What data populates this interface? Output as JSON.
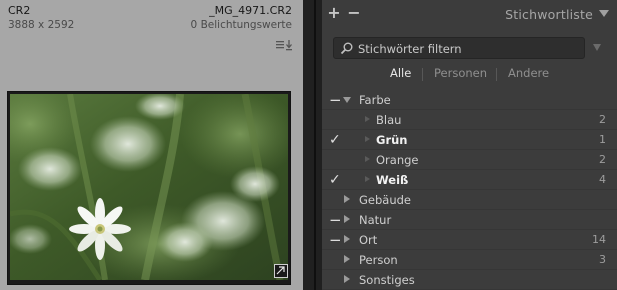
{
  "grid_cell": {
    "filename_left": "CR2",
    "dimensions": "3888 x 2592",
    "filename_right": "_MG_4971.CR2",
    "flags": "0 Belichtungswerte",
    "meta_icon": "metadata-menu-icon",
    "badge_icon": "crop-badge-icon"
  },
  "keyword_panel": {
    "title": "Stichwortliste",
    "add_label": "+",
    "remove_label": "−",
    "filter_placeholder": "Stichwörter filtern",
    "tabs": [
      {
        "label": "Alle",
        "active": true
      },
      {
        "label": "Personen",
        "active": false
      },
      {
        "label": "Andere",
        "active": false
      }
    ],
    "keywords": [
      {
        "mark": "−",
        "expand": "down",
        "label": "Farbe",
        "count": "",
        "level": 0
      },
      {
        "mark": "",
        "expand": "",
        "label": "Blau",
        "count": "2",
        "level": 1
      },
      {
        "mark": "✓",
        "expand": "",
        "label": "Grün",
        "count": "1",
        "level": 1
      },
      {
        "mark": "",
        "expand": "",
        "label": "Orange",
        "count": "2",
        "level": 1
      },
      {
        "mark": "✓",
        "expand": "",
        "label": "Weiß",
        "count": "4",
        "level": 1
      },
      {
        "mark": "",
        "expand": "right",
        "label": "Gebäude",
        "count": "",
        "level": 0
      },
      {
        "mark": "−",
        "expand": "right",
        "label": "Natur",
        "count": "",
        "level": 0
      },
      {
        "mark": "−",
        "expand": "right",
        "label": "Ort",
        "count": "14",
        "level": 0
      },
      {
        "mark": "",
        "expand": "right",
        "label": "Person",
        "count": "3",
        "level": 0
      },
      {
        "mark": "",
        "expand": "right",
        "label": "Sonstiges",
        "count": "",
        "level": 0
      }
    ]
  },
  "colors": {
    "grid_cell_bg": "#a7a7a7",
    "panel_bg": "#3c3c3c",
    "app_bg": "#1d1d1d"
  }
}
